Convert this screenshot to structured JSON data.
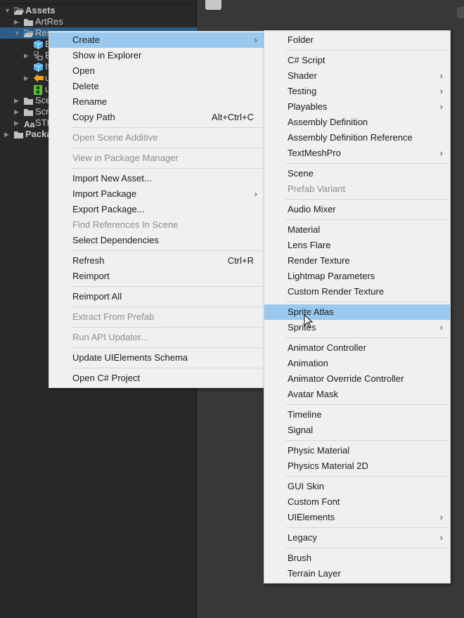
{
  "tree": [
    {
      "label": "Assets",
      "indent": 0,
      "open": true,
      "icon": "folder-open-icon",
      "bold": true
    },
    {
      "label": "ArtRes",
      "indent": 1,
      "open": false,
      "icon": "folder-icon"
    },
    {
      "label": "Res",
      "indent": 1,
      "open": true,
      "icon": "folder-open-icon",
      "selected": true
    },
    {
      "label": "B",
      "indent": 2,
      "icon": "prefab-cube-icon"
    },
    {
      "label": "B",
      "indent": 2,
      "open": false,
      "icon": "nested-prefab-icon"
    },
    {
      "label": "It",
      "indent": 2,
      "icon": "prefab-cube-icon"
    },
    {
      "label": "u",
      "indent": 2,
      "open": false,
      "icon": "orange-arrow-icon"
    },
    {
      "label": "u",
      "indent": 2,
      "icon": "green-asset-icon"
    },
    {
      "label": "Sce",
      "indent": 1,
      "open": false,
      "icon": "folder-icon"
    },
    {
      "label": "Scr",
      "indent": 1,
      "open": false,
      "icon": "folder-icon"
    },
    {
      "label": "STH",
      "indent": 1,
      "open": false,
      "icon": "font-aa-icon"
    },
    {
      "label": "Packa",
      "indent": 0,
      "open": false,
      "icon": "folder-icon",
      "bold": true
    }
  ],
  "context_menu": [
    {
      "label": "Create",
      "submenu": true,
      "highlighted": true
    },
    {
      "label": "Show in Explorer"
    },
    {
      "label": "Open"
    },
    {
      "label": "Delete"
    },
    {
      "label": "Rename"
    },
    {
      "label": "Copy Path",
      "shortcut": "Alt+Ctrl+C"
    },
    {
      "sep": true
    },
    {
      "label": "Open Scene Additive",
      "disabled": true
    },
    {
      "sep": true
    },
    {
      "label": "View in Package Manager",
      "disabled": true
    },
    {
      "sep": true
    },
    {
      "label": "Import New Asset..."
    },
    {
      "label": "Import Package",
      "submenu": true
    },
    {
      "label": "Export Package..."
    },
    {
      "label": "Find References In Scene",
      "disabled": true
    },
    {
      "label": "Select Dependencies"
    },
    {
      "sep": true
    },
    {
      "label": "Refresh",
      "shortcut": "Ctrl+R"
    },
    {
      "label": "Reimport"
    },
    {
      "sep": true
    },
    {
      "label": "Reimport All"
    },
    {
      "sep": true
    },
    {
      "label": "Extract From Prefab",
      "disabled": true
    },
    {
      "sep": true
    },
    {
      "label": "Run API Updater...",
      "disabled": true
    },
    {
      "sep": true
    },
    {
      "label": "Update UIElements Schema"
    },
    {
      "sep": true
    },
    {
      "label": "Open C# Project"
    }
  ],
  "create_submenu": [
    {
      "label": "Folder"
    },
    {
      "sep": true
    },
    {
      "label": "C# Script"
    },
    {
      "label": "Shader",
      "submenu": true
    },
    {
      "label": "Testing",
      "submenu": true
    },
    {
      "label": "Playables",
      "submenu": true
    },
    {
      "label": "Assembly Definition"
    },
    {
      "label": "Assembly Definition Reference"
    },
    {
      "label": "TextMeshPro",
      "submenu": true
    },
    {
      "sep": true
    },
    {
      "label": "Scene"
    },
    {
      "label": "Prefab Variant",
      "disabled": true
    },
    {
      "sep": true
    },
    {
      "label": "Audio Mixer"
    },
    {
      "sep": true
    },
    {
      "label": "Material"
    },
    {
      "label": "Lens Flare"
    },
    {
      "label": "Render Texture"
    },
    {
      "label": "Lightmap Parameters"
    },
    {
      "label": "Custom Render Texture"
    },
    {
      "sep": true
    },
    {
      "label": "Sprite Atlas",
      "highlighted": true
    },
    {
      "label": "Sprites",
      "submenu": true
    },
    {
      "sep": true
    },
    {
      "label": "Animator Controller"
    },
    {
      "label": "Animation"
    },
    {
      "label": "Animator Override Controller"
    },
    {
      "label": "Avatar Mask"
    },
    {
      "sep": true
    },
    {
      "label": "Timeline"
    },
    {
      "label": "Signal"
    },
    {
      "sep": true
    },
    {
      "label": "Physic Material"
    },
    {
      "label": "Physics Material 2D"
    },
    {
      "sep": true
    },
    {
      "label": "GUI Skin"
    },
    {
      "label": "Custom Font"
    },
    {
      "label": "UIElements",
      "submenu": true
    },
    {
      "sep": true
    },
    {
      "label": "Legacy",
      "submenu": true
    },
    {
      "sep": true
    },
    {
      "label": "Brush"
    },
    {
      "label": "Terrain Layer"
    }
  ],
  "colors": {
    "highlight": "#99c9ef",
    "selection": "#2c5d87",
    "menu_bg": "#f0f0f0"
  }
}
